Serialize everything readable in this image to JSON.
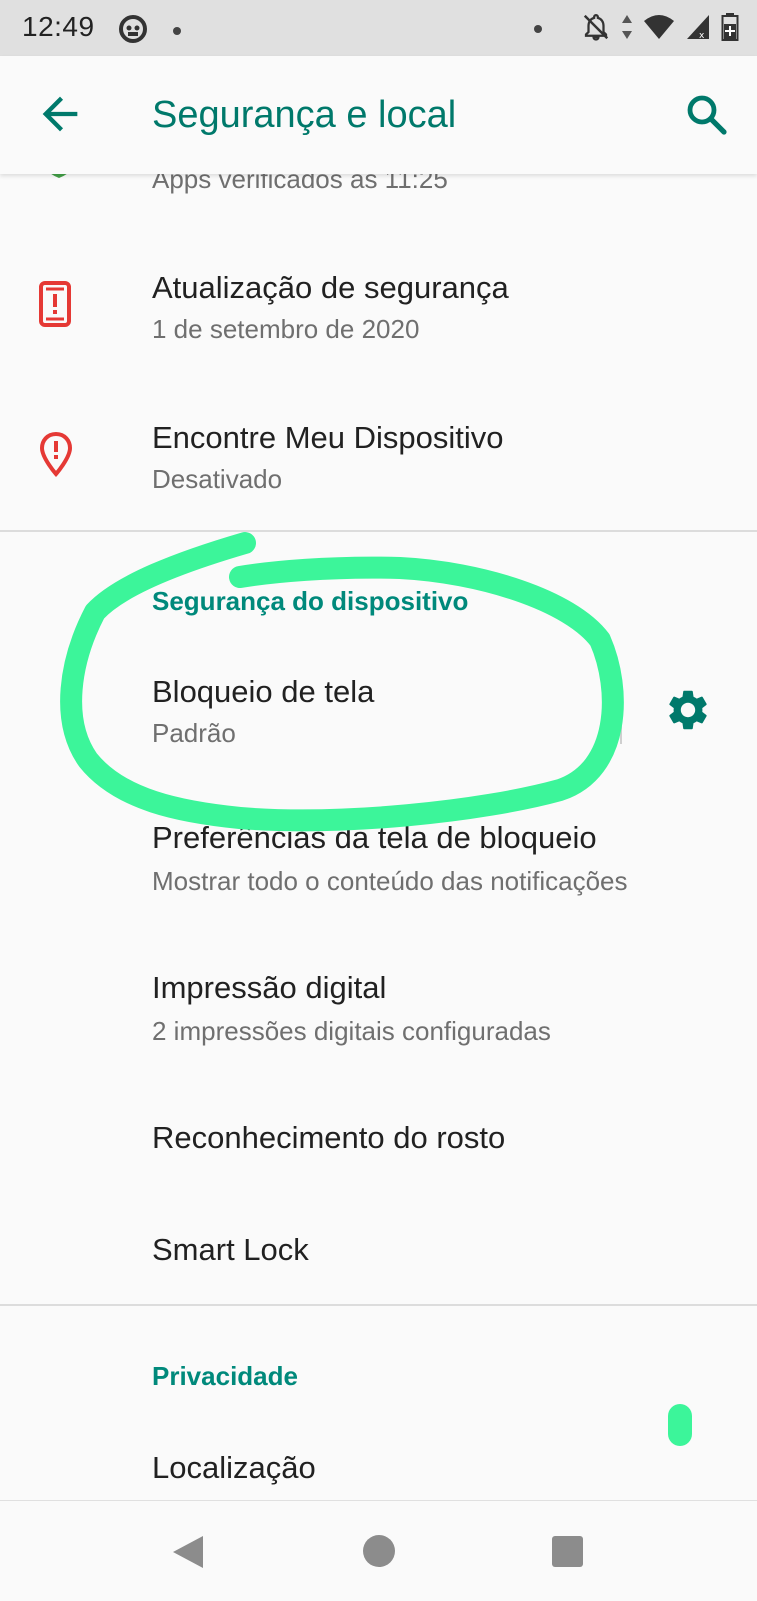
{
  "status_bar": {
    "time": "12:49",
    "icons": [
      "face-notification-icon",
      "dot-icon",
      "dot-icon",
      "notifications-off-icon",
      "data-arrows-icon",
      "wifi-icon",
      "signal-icon",
      "battery-icon"
    ]
  },
  "app_bar": {
    "title": "Segurança e local",
    "back_icon": "arrow-back-icon",
    "search_icon": "search-icon"
  },
  "rows_top": [
    {
      "title": "",
      "subtitle": "Apps verificados às 11:25",
      "icon": "shield-check-icon"
    },
    {
      "title": "Atualização de segurança",
      "subtitle": "1 de setembro de 2020",
      "icon": "phone-alert-icon"
    },
    {
      "title": "Encontre Meu Dispositivo",
      "subtitle": "Desativado",
      "icon": "location-alert-icon"
    }
  ],
  "device_security": {
    "header": "Segurança do dispositivo",
    "items": [
      {
        "title": "Bloqueio de tela",
        "subtitle": "Padrão",
        "action_icon": "gear-icon"
      },
      {
        "title": "Preferências da tela de bloqueio",
        "subtitle": "Mostrar todo o conteúdo das notificações"
      },
      {
        "title": "Impressão digital",
        "subtitle": "2 impressões digitais configuradas"
      },
      {
        "title": "Reconhecimento do rosto",
        "subtitle": ""
      },
      {
        "title": "Smart Lock",
        "subtitle": ""
      }
    ]
  },
  "privacy": {
    "header": "Privacidade",
    "items": [
      {
        "title": "Localização"
      }
    ]
  },
  "colors": {
    "accent": "#00897b",
    "title_accent": "#00796b",
    "alert_icon": "#e53935",
    "annotation_marker": "#3cf59a"
  },
  "nav_bar": {
    "icons": [
      "nav-back-icon",
      "nav-home-icon",
      "nav-recents-icon"
    ]
  }
}
